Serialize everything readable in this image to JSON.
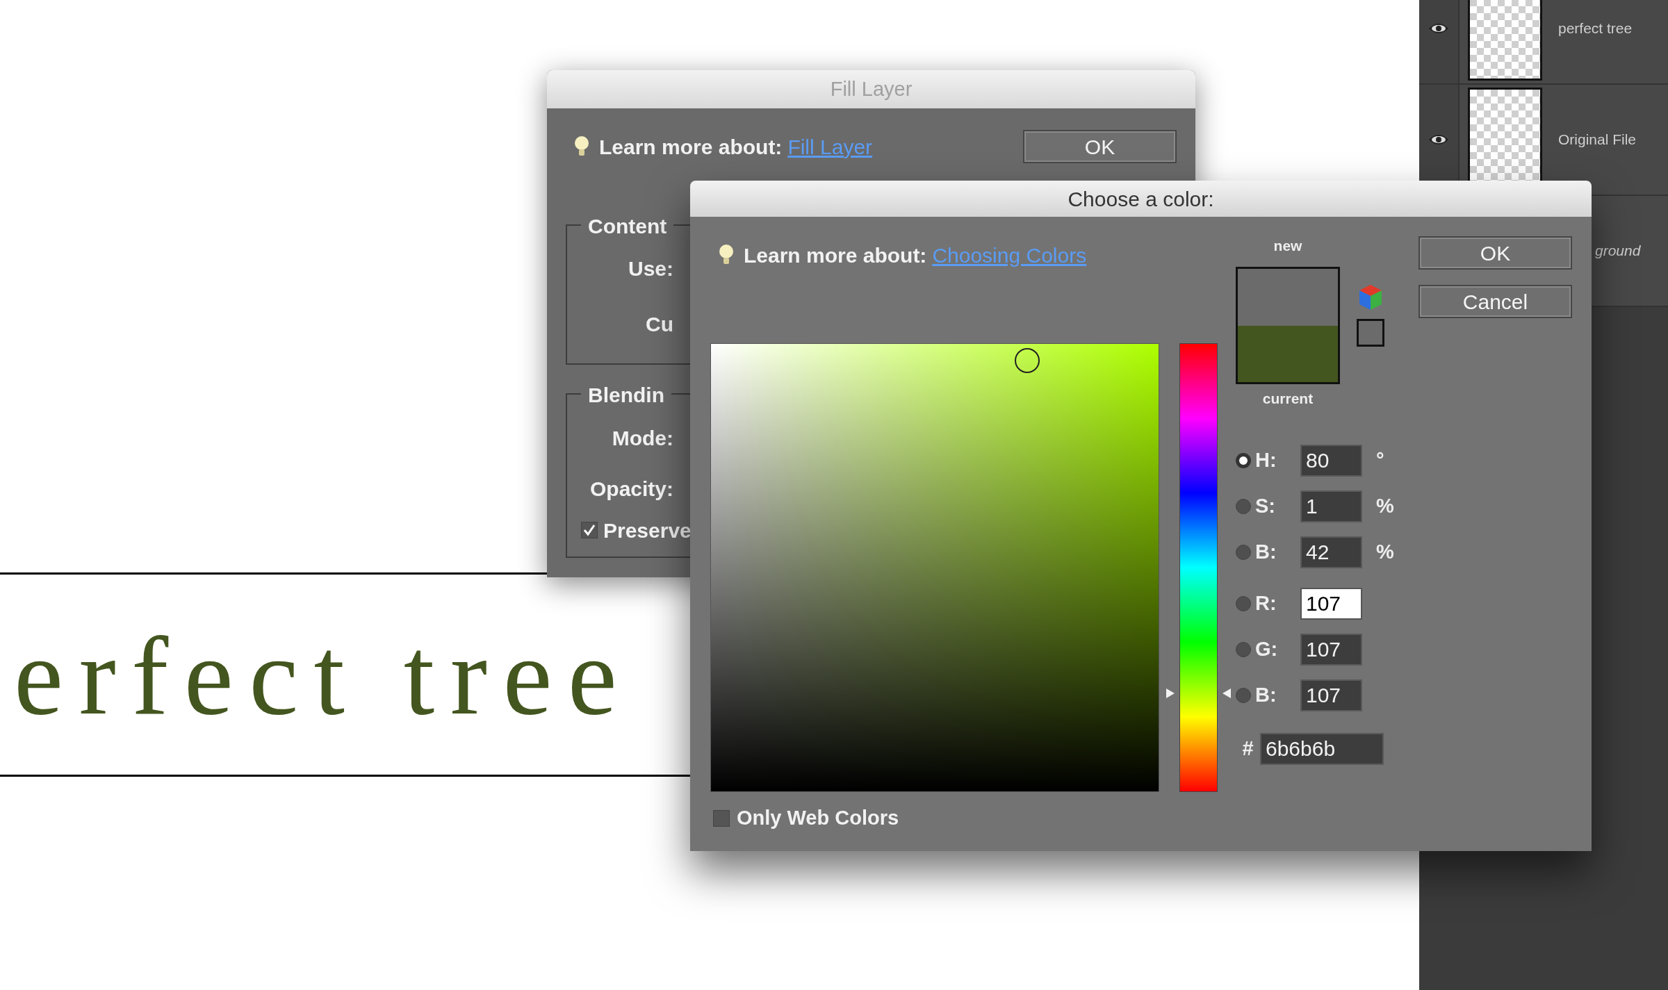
{
  "canvas": {
    "heading": "erfect tree"
  },
  "layers": [
    {
      "name": "perfect tree",
      "visible": true
    },
    {
      "name": "Original File",
      "visible": true
    },
    {
      "name": "ground",
      "italic": true
    }
  ],
  "fill_layer_dialog": {
    "title": "Fill Layer",
    "learn_more": {
      "label": "Learn more about:",
      "link": "Fill Layer"
    },
    "ok_button": "OK",
    "groups": [
      {
        "legend": "Content",
        "labels": [
          "Use:",
          "Cu"
        ]
      },
      {
        "legend": "Blendin",
        "labels": [
          "Mode:",
          "Opacity:"
        ],
        "checkbox": {
          "label": "Preserve",
          "checked": true
        }
      }
    ]
  },
  "color_dialog": {
    "title": "Choose a color:",
    "learn_more": {
      "label": "Learn more about:",
      "link": "Choosing Colors"
    },
    "hue_slider": {
      "level": 0.22
    },
    "only_web_colors": {
      "label": "Only Web Colors",
      "checked": false
    },
    "swatches": [
      {
        "label": "new",
        "color": "#6b6b6b"
      },
      {
        "label": "current",
        "color": "#44561f"
      }
    ],
    "hsb_values": [
      {
        "label": "H:",
        "value": "80",
        "unit": "°",
        "selected": true,
        "focused": false
      },
      {
        "label": "S:",
        "value": "1",
        "unit": "%",
        "selected": false,
        "focused": false
      },
      {
        "label": "B:",
        "value": "42",
        "unit": "%",
        "selected": false,
        "focused": false
      }
    ],
    "rgb_values": [
      {
        "label": "R:",
        "value": "107",
        "selected": false,
        "focused": true
      },
      {
        "label": "G:",
        "value": "107",
        "selected": false,
        "focused": false
      },
      {
        "label": "B:",
        "value": "107",
        "selected": false,
        "focused": false
      }
    ],
    "hex": {
      "label": "#",
      "value": "6b6b6b"
    },
    "buttons": [
      "OK",
      "Cancel"
    ]
  }
}
